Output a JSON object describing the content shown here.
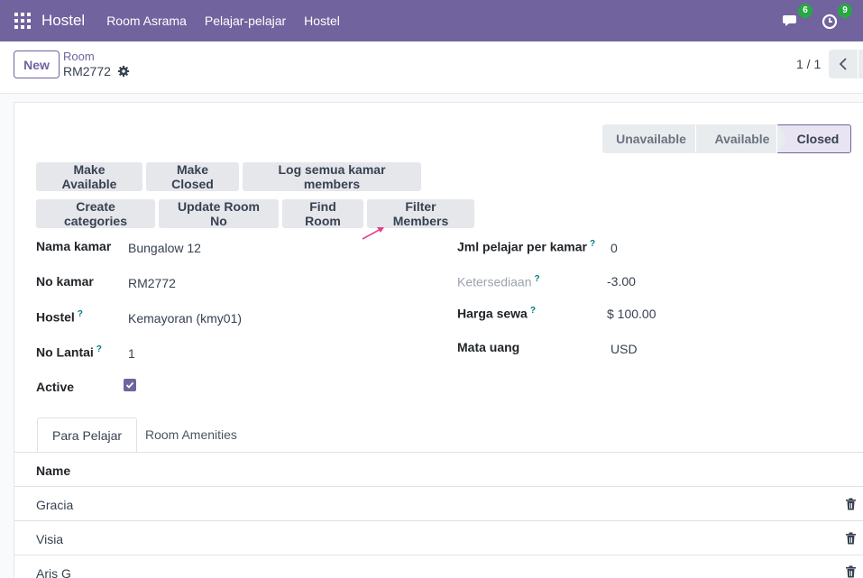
{
  "navbar": {
    "brand": "Hostel",
    "menu": [
      "Room Asrama",
      "Pelajar-pelajar",
      "Hostel"
    ],
    "messages_count": "6",
    "activities_count": "9"
  },
  "control_panel": {
    "new_label": "New",
    "breadcrumb": "Room",
    "record_name": "RM2772",
    "pager": "1 / 1"
  },
  "statusbar": {
    "stages": [
      "Unavailable",
      "Available",
      "Closed"
    ],
    "current": "Closed"
  },
  "actions": {
    "make_available": "Make Available",
    "make_closed": "Make Closed",
    "log_members": "Log semua kamar members",
    "create_categories": "Create categories",
    "update_room_no": "Update Room No",
    "find_room": "Find Room",
    "filter_members": "Filter Members"
  },
  "fields_left": {
    "nama_kamar_label": "Nama kamar",
    "nama_kamar": "Bungalow 12",
    "no_kamar_label": "No kamar",
    "no_kamar": "RM2772",
    "hostel_label": "Hostel",
    "hostel": "Kemayoran (kmy01)",
    "no_lantai_label": "No Lantai",
    "no_lantai": "1",
    "active_label": "Active",
    "active": true
  },
  "fields_right": {
    "jml_label": "Jml pelajar per kamar",
    "jml": "0",
    "ketersediaan_label": "Ketersediaan",
    "ketersediaan": "-3.00",
    "harga_label": "Harga sewa",
    "harga": "$ 100.00",
    "mata_uang_label": "Mata uang",
    "mata_uang": "USD"
  },
  "help_mark": "?",
  "tabs": [
    "Para Pelajar",
    "Room Amenities"
  ],
  "list": {
    "header": "Name",
    "rows": [
      "Gracia",
      "Visia",
      "Aris G"
    ]
  },
  "colors": {
    "brand": "#71639e",
    "badge": "#28a745",
    "arrow": "#e83e8c"
  }
}
